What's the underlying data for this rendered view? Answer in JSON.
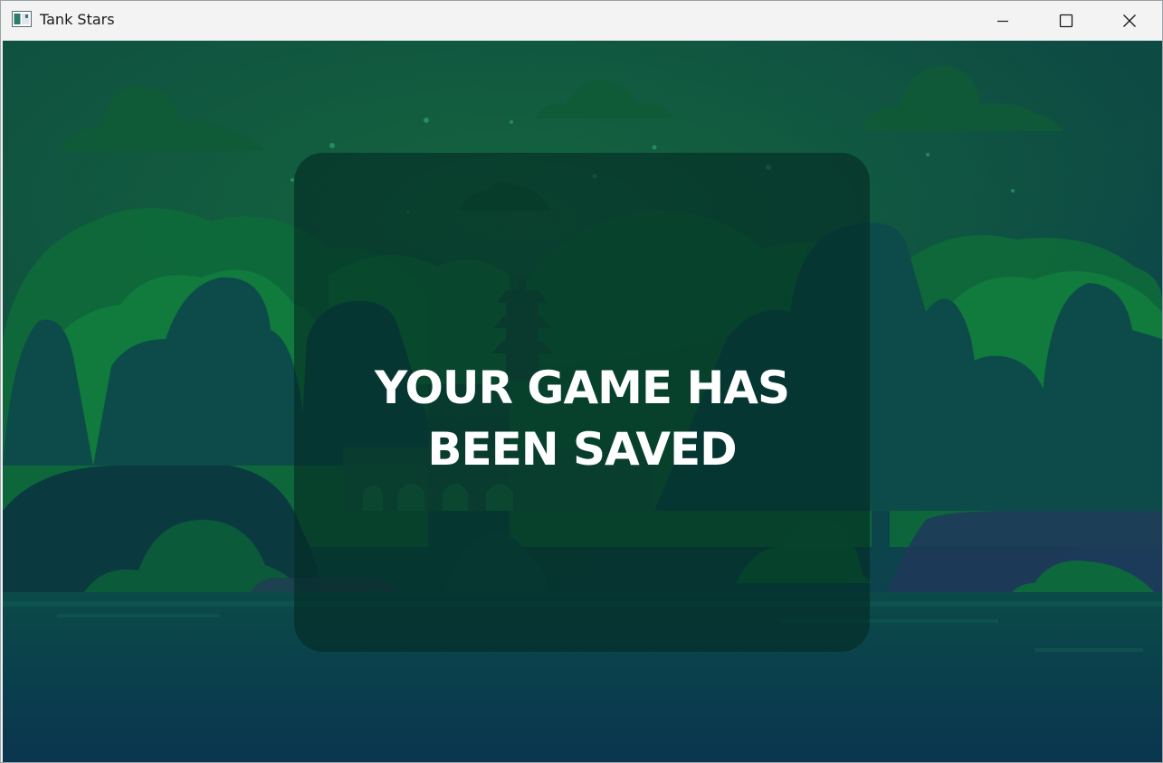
{
  "window": {
    "title": "Tank Stars",
    "controls": {
      "minimize_icon": "minimize-icon",
      "maximize_icon": "maximize-icon",
      "close_icon": "close-icon"
    }
  },
  "game": {
    "scene": "forest-mountain-background",
    "dialog": {
      "line1": "YOUR GAME HAS",
      "line2": "BEEN SAVED"
    }
  },
  "colors": {
    "titlebar_bg": "#f3f3f3",
    "sky_top": "#0e4a3e",
    "sky_bottom": "#0b3450",
    "tree_green": "#0f6a3a",
    "mountain": "#0c4b45",
    "dialog_overlay": "#042a24",
    "text": "#ffffff"
  }
}
